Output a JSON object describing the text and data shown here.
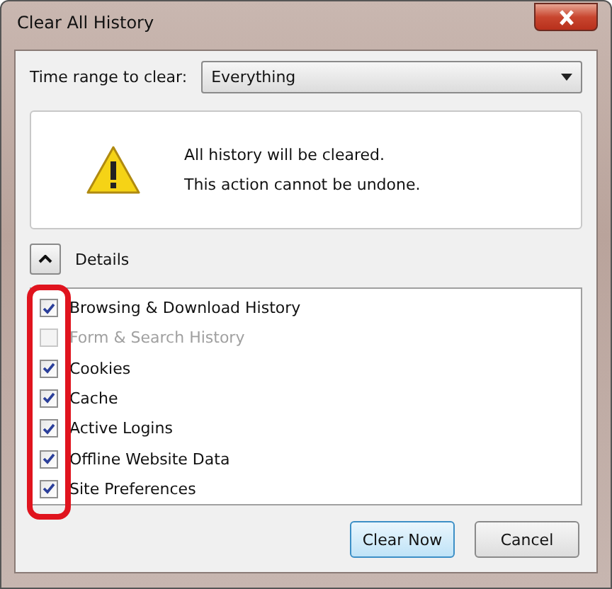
{
  "window": {
    "title": "Clear All History"
  },
  "time_range": {
    "label": "Time range to clear:",
    "value": "Everything"
  },
  "warning": {
    "lines": [
      "All history will be cleared.",
      "This action cannot be undone."
    ]
  },
  "details": {
    "label": "Details",
    "expanded": true
  },
  "items": [
    {
      "label": "Browsing & Download History",
      "checked": true,
      "disabled": false
    },
    {
      "label": "Form & Search History",
      "checked": false,
      "disabled": true
    },
    {
      "label": "Cookies",
      "checked": true,
      "disabled": false
    },
    {
      "label": "Cache",
      "checked": true,
      "disabled": false
    },
    {
      "label": "Active Logins",
      "checked": true,
      "disabled": false
    },
    {
      "label": "Offline Website Data",
      "checked": true,
      "disabled": false
    },
    {
      "label": "Site Preferences",
      "checked": true,
      "disabled": false
    }
  ],
  "buttons": [
    {
      "label": "Clear Now",
      "default": true
    },
    {
      "label": "Cancel",
      "default": false
    }
  ]
}
